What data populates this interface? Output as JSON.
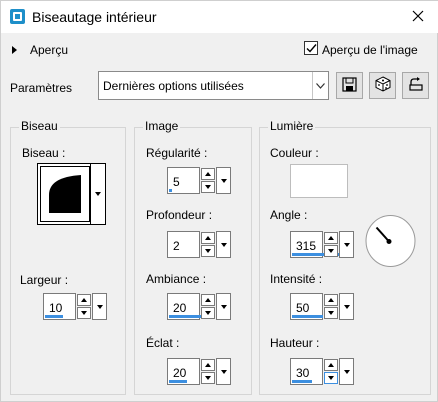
{
  "window": {
    "title": "Biseautage intérieur",
    "icon": "bevel-app-icon",
    "close_icon": "close-icon"
  },
  "preview": {
    "label": "Aperçu",
    "checkbox_label": "Aperçu de l'image",
    "checkbox_checked": true
  },
  "params": {
    "label": "Paramètres",
    "preset_value": "Dernières options utilisées",
    "buttons": [
      "save-icon",
      "random-dice-icon",
      "reset-icon"
    ]
  },
  "groups": {
    "biseau": {
      "title": "Biseau",
      "bevel_label": "Biseau :",
      "width_label": "Largeur :",
      "width_value": "10"
    },
    "image": {
      "title": "Image",
      "regularite_label": "Régularité :",
      "regularite_value": "5",
      "profondeur_label": "Profondeur :",
      "profondeur_value": "2",
      "ambiance_label": "Ambiance :",
      "ambiance_value": "20",
      "eclat_label": "Éclat :",
      "eclat_value": "20"
    },
    "lumiere": {
      "title": "Lumière",
      "couleur_label": "Couleur :",
      "couleur_value": "#ffffff",
      "angle_label": "Angle :",
      "angle_value": "315",
      "intensite_label": "Intensité :",
      "intensite_value": "50",
      "hauteur_label": "Hauteur :",
      "hauteur_value": "30"
    }
  },
  "colors": {
    "accent": "#3c8fe0",
    "background": "#f0f0f0"
  }
}
